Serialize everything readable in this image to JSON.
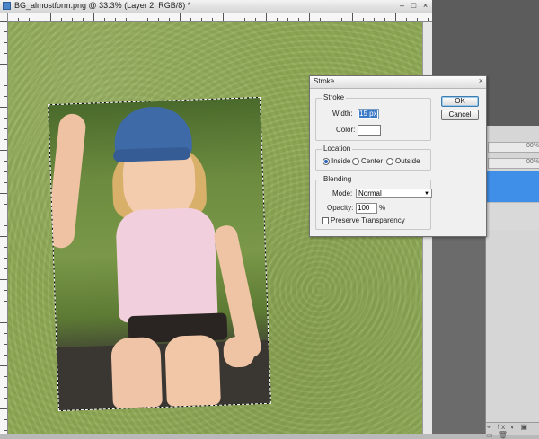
{
  "document": {
    "title": "BG_almostform.png @ 33.3% (Layer 2, RGB/8) *",
    "minimize": "–",
    "maximize": "□",
    "close": "×"
  },
  "dialog": {
    "title": "Stroke",
    "close": "×",
    "stroke_group": "Stroke",
    "width_label": "Width:",
    "width_value": "15 px",
    "color_label": "Color:",
    "location_group": "Location",
    "location_options": [
      "Inside",
      "Center",
      "Outside"
    ],
    "location_selected": "Inside",
    "blending_group": "Blending",
    "mode_label": "Mode:",
    "mode_value": "Normal",
    "opacity_label": "Opacity:",
    "opacity_value": "100",
    "opacity_unit": "%",
    "preserve_label": "Preserve Transparency",
    "ok_label": "OK",
    "cancel_label": "Cancel"
  },
  "layers_panel": {
    "opacity_snippet_1": "00%",
    "opacity_snippet_2": "00%",
    "footer_icons": "⚭ fx ◐ ▣ ▭ 🗑"
  },
  "colors": {
    "canvas_green": "#8fab58",
    "selected_layer": "#3f8fe8"
  }
}
